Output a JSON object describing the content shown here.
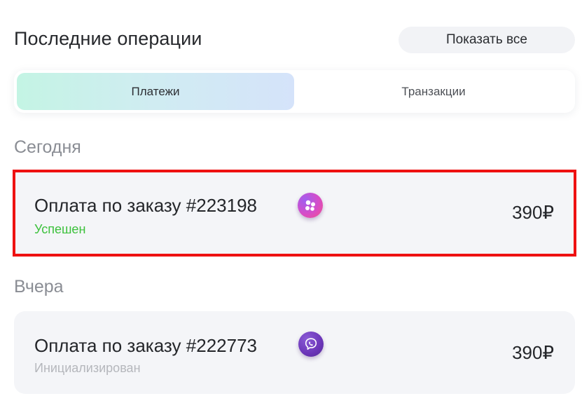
{
  "header": {
    "title": "Последние операции",
    "show_all_label": "Показать все"
  },
  "tabs": [
    {
      "label": "Платежи",
      "active": true
    },
    {
      "label": "Транзакции",
      "active": false
    }
  ],
  "groups": [
    {
      "date_label": "Сегодня",
      "operations": [
        {
          "title": "Оплата по заказу #223198",
          "status": "Успешен",
          "status_color": "#3cc13c",
          "amount": "390₽",
          "icon": "dots-app-icon"
        }
      ]
    },
    {
      "date_label": "Вчера",
      "operations": [
        {
          "title": "Оплата по заказу #222773",
          "status": "Инициализирован",
          "status_color": "#b5b7bc",
          "amount": "390₽",
          "icon": "viber-icon"
        }
      ]
    }
  ],
  "colors": {
    "highlight_border": "#ee1111",
    "active_tab_gradient": [
      "#c4f4e4",
      "#d5e3fa"
    ]
  }
}
